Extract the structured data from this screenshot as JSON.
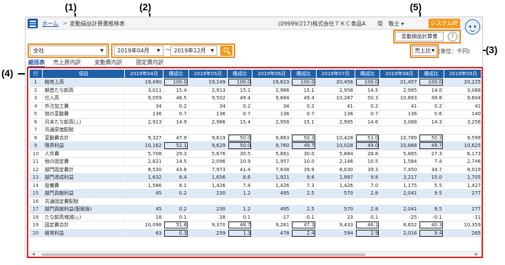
{
  "callouts": {
    "c1": "(1)",
    "c2": "(2)",
    "c3": "(3)",
    "c4": "(4)",
    "c5": "(5)"
  },
  "topbar": {
    "home": "ホーム",
    "separator": ">",
    "current": "変動損益計算書推移表",
    "company": "(09999/217)株式会社ＴＫＣ食品A",
    "user": "堤　敬士 ▾",
    "end_button": "システム終了"
  },
  "toolbar": {
    "report_button": "変動損益計算書",
    "help": "?"
  },
  "filters": {
    "department": "全社",
    "from_month": "2019年04月",
    "range_sep": "〜",
    "to_month": "2019年12月",
    "ratio": "売上比",
    "unit": "(単位：千円)"
  },
  "tabs": [
    "総括表",
    "売上原内訳",
    "変動費内訳",
    "固定費内訳"
  ],
  "table": {
    "headers": [
      "行",
      "項目",
      "2019年04月",
      "構成比",
      "2019年05月",
      "構成比",
      "2019年06月",
      "構成比",
      "2019年07月",
      "構成比",
      "2019年08月",
      "構成比",
      "2019年09月"
    ],
    "rows": [
      {
        "no": "1",
        "name": "純売上高",
        "hl": true,
        "v": [
          "19,490",
          "100.0",
          "19,249",
          "100.0",
          "19,623",
          "100.0",
          "20,456",
          "100.0",
          "21,457",
          "100.0",
          "20,225"
        ]
      },
      {
        "no": "2",
        "name": "期首たな卸高",
        "hl": false,
        "v": [
          "3,011",
          "15.4",
          "2,913",
          "15.1",
          "2,966",
          "15.1",
          "2,958",
          "14.5",
          "2,995",
          "14.0",
          "3,068"
        ]
      },
      {
        "no": "3",
        "name": "仕入高",
        "hl": false,
        "v": [
          "9,059",
          "46.5",
          "9,502",
          "49.4",
          "9,684",
          "49.4",
          "10,287",
          "50.3",
          "10,683",
          "49.8",
          "9,604"
        ]
      },
      {
        "no": "4",
        "name": "外注加工費",
        "hl": false,
        "v": [
          "34",
          "0.2",
          "34",
          "0.2",
          "34",
          "0.2",
          "41",
          "0.2",
          "41",
          "0.2",
          "41"
        ]
      },
      {
        "no": "5",
        "name": "他の変動費",
        "hl": false,
        "v": [
          "136",
          "0.7",
          "136",
          "0.7",
          "136",
          "0.7",
          "136",
          "0.7",
          "136",
          "0.6",
          "140"
        ]
      },
      {
        "no": "6",
        "name": "月末たな卸高(△)",
        "hl": false,
        "v": [
          "2,913",
          "14.9",
          "2,966",
          "15.4",
          "2,958",
          "15.1",
          "2,995",
          "14.6",
          "3,068",
          "14.3",
          "3,256"
        ]
      },
      {
        "no": "7",
        "name": "共通原価配賦",
        "hl": false,
        "v": [
          "",
          "",
          "",
          "",
          "",
          "",
          "",
          "",
          "",
          "",
          ""
        ]
      },
      {
        "no": "8",
        "name": "変動費合計",
        "hl": false,
        "v": [
          "9,327",
          "47.9",
          "9,619",
          "50.0",
          "9,863",
          "50.3",
          "10,428",
          "51.0",
          "10,789",
          "50.3",
          "9,599"
        ]
      },
      {
        "no": "9",
        "name": "限界利益",
        "hl": true,
        "v": [
          "10,162",
          "52.1",
          "9,629",
          "50.0",
          "9,760",
          "49.7",
          "10,028",
          "49.0",
          "10,668",
          "49.7",
          "10,625"
        ]
      },
      {
        "no": "10",
        "name": "人件費",
        "hl": false,
        "v": [
          "5,708",
          "29.3",
          "5,876",
          "30.5",
          "5,881",
          "30.0",
          "5,884",
          "28.8",
          "5,865",
          "27.3",
          "6,173"
        ]
      },
      {
        "no": "11",
        "name": "他の固定費",
        "hl": false,
        "v": [
          "2,821",
          "14.5",
          "2,096",
          "10.9",
          "1,957",
          "10.0",
          "2,146",
          "10.5",
          "1,584",
          "7.4",
          "2,746"
        ]
      },
      {
        "no": "12",
        "name": "部門固定費計",
        "hl": false,
        "v": [
          "8,530",
          "43.8",
          "7,973",
          "41.4",
          "7,838",
          "39.9",
          "8,030",
          "39.3",
          "7,450",
          "34.7",
          "8,919"
        ]
      },
      {
        "no": "13",
        "name": "部門達成利益",
        "hl": true,
        "v": [
          "1,632",
          "8.4",
          "1,656",
          "8.6",
          "1,921",
          "9.8",
          "1,997",
          "9.8",
          "3,217",
          "15.0",
          "1,705"
        ]
      },
      {
        "no": "14",
        "name": "設備費",
        "hl": false,
        "v": [
          "1,586",
          "8.1",
          "1,426",
          "7.4",
          "1,426",
          "7.3",
          "1,426",
          "7.0",
          "1,175",
          "5.5",
          "1,427"
        ]
      },
      {
        "no": "15",
        "name": "部門貢献利益",
        "hl": true,
        "v": [
          "45",
          "0.2",
          "230",
          "1.2",
          "495",
          "2.5",
          "570",
          "2.8",
          "2,041",
          "9.5",
          "277"
        ]
      },
      {
        "no": "16",
        "name": "共通固定費配賦",
        "hl": false,
        "v": [
          "",
          "",
          "",
          "",
          "",
          "",
          "",
          "",
          "",
          "",
          ""
        ]
      },
      {
        "no": "17",
        "name": "部門貢献利益(配賦後)",
        "hl": true,
        "v": [
          "45",
          "0.2",
          "230",
          "1.2",
          "495",
          "2.5",
          "570",
          "2.8",
          "2,041",
          "9.5",
          "277"
        ]
      },
      {
        "no": "18",
        "name": "たな卸高増減(△)",
        "hl": false,
        "v": [
          "18",
          "0.1",
          "28",
          "0.1",
          "-17",
          "-0.1",
          "23",
          "0.1",
          "-25",
          "-0.1",
          "-11"
        ]
      },
      {
        "no": "19",
        "name": "固定費合計",
        "hl": false,
        "v": [
          "10,098",
          "51.8",
          "9,370",
          "48.7",
          "9,281",
          "47.3",
          "9,433",
          "46.1",
          "8,652",
          "40.3",
          "10,359"
        ]
      },
      {
        "no": "20",
        "name": "経常利益",
        "hl": true,
        "v": [
          "63",
          "0.3",
          "259",
          "1.3",
          "478",
          "2.4",
          "594",
          "2.9",
          "2,016",
          "9.4",
          "265"
        ]
      }
    ],
    "boxed_cells": [
      "1-1",
      "1-3",
      "1-5",
      "1-7",
      "1-9",
      "8-3",
      "8-5",
      "8-7",
      "8-9",
      "9-1",
      "9-3",
      "9-5",
      "9-7",
      "9-9",
      "19-1",
      "19-3",
      "19-5",
      "19-7",
      "19-9",
      "20-1",
      "20-3",
      "20-5",
      "20-7",
      "20-9"
    ]
  }
}
